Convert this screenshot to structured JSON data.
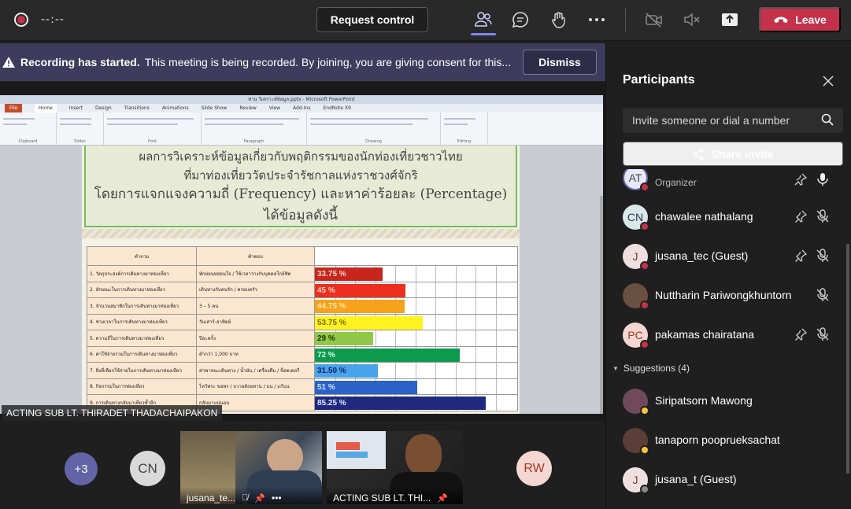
{
  "topbar": {
    "timer": "--:--",
    "request_control": "Request control",
    "leave": "Leave"
  },
  "banner": {
    "title": "Recording has started.",
    "message": "This meeting is being recorded. By joining, you are giving consent for this...",
    "dismiss": "Dismiss"
  },
  "share": {
    "presenter": "ACTING SUB LT. THIRADET THADACHAIPAKON",
    "ppt_title": "ท่าน วิเคราะห์ข้อมูล.pptx - Microsoft PowerPoint",
    "ppt_tabs": [
      "File",
      "Home",
      "Insert",
      "Design",
      "Transitions",
      "Animations",
      "Slide Show",
      "Review",
      "View",
      "Add-Ins",
      "EndNote X9"
    ],
    "ribbon_groups": [
      "Clipboard",
      "Slides",
      "Font",
      "Paragraph",
      "Drawing",
      "Editing"
    ],
    "slide": {
      "line1": "ผลการวิเคราะห์ข้อมูลเกี่ยวกับพฤติกรรมของนักท่องเที่ยวชาวไทย",
      "line2": "ที่มาท่องเที่ยววัดประจำรัชกาลแห่งราชวงศ์จักริ",
      "line3": "โดยการแจกแจงความถี่ (Frequency) และหาค่าร้อยละ (Percentage) ได้ข้อมูลดังนี้",
      "col_q": "คำถาม",
      "col_a": "คำตอบ",
      "rows": [
        {
          "q": "1. วัตถุประสงค์การเดินทางมาท่องเที่ยว",
          "a": "พักผ่อนหย่อนใจ / ใช้เวลาว่างกับบุคคลใกล้ชิด",
          "label": "33.75 %",
          "value": 33.75,
          "color": "#c8251d",
          "text": "#ffd7c9"
        },
        {
          "q": "2. ลักษณะในการเดินทางมาท่องเที่ยว",
          "a": "เดินทางกับคนรัก / ครอบครัว",
          "label": "45 %",
          "value": 45,
          "color": "#ee2e1f",
          "text": "#ffd2c2"
        },
        {
          "q": "3. จำนวนสมาชิกในการเดินทางมาท่องเที่ยว",
          "a": "3 – 5 คน",
          "label": "44.75 %",
          "value": 44.75,
          "color": "#f7a21b",
          "text": "#ffe7a8"
        },
        {
          "q": "4. ช่วงเวลาในการเดินทางมาท่องเที่ยว",
          "a": "วันเสาร์-อาทิตย์",
          "label": "53.75 %",
          "value": 53.75,
          "color": "#fff21f",
          "text": "#7a6a00"
        },
        {
          "q": "5. ความถี่ในการเดินทางมาท่องเที่ยว",
          "a": "ปีละครั้ง",
          "label": "29 %",
          "value": 29,
          "color": "#92c847",
          "text": "#203400"
        },
        {
          "q": "6. ค่าใช้จ่ายรวมในการเดินทางมาท่องเที่ยว",
          "a": "ต่ำกว่า 1,000 บาท",
          "label": "72 %",
          "value": 72,
          "color": "#0e9a4d",
          "text": "#d9ffe6"
        },
        {
          "q": "7. สิ่งที่เลือกใช้จ่ายในการเดินทางมาท่องเที่ยว",
          "a": "ค่าพาหนะเดินทาง / น้ำมัน / เครื่องดื่ม / ช็อตเตอรี่",
          "label": "31.50 %",
          "value": 31.5,
          "color": "#48a3e8",
          "text": "#10206a"
        },
        {
          "q": "8. กิจกรรมในการท่องเที่ยว",
          "a": "ไหว้พระ ขอพร / ถวายสังฆทาน / บน / แก้บน",
          "label": "51 %",
          "value": 51,
          "color": "#2a62c8",
          "text": "#cde0ff"
        },
        {
          "q": "9. การเดินทางกลับมาเที่ยวซ้ำอีก",
          "a": "กลับมาแน่นอน",
          "label": "85.25 %",
          "value": 85.25,
          "color": "#1f2a7e",
          "text": "#e0e6ff"
        }
      ]
    }
  },
  "bottom": {
    "more_count": "+3",
    "cn_initials": "CN",
    "rw_initials": "RW",
    "tile1_name": "jusana_te...",
    "tile2_name": "ACTING SUB LT. THI..."
  },
  "panel": {
    "title": "Participants",
    "invite_placeholder": "Invite someone or dial a number",
    "share_invite": "Share invite",
    "organizer_label": "Organizer",
    "organizer_initials": "AT",
    "participants": [
      {
        "initials": "CN",
        "name": "chawalee nathalang",
        "status_color": "#c4314b"
      },
      {
        "initials": "J",
        "name": "jusana_tec (Guest)",
        "status_color": "#c4314b"
      },
      {
        "initials": "",
        "name": "Nuttharin Pariwongkhuntorn",
        "status_color": "#c4314b"
      },
      {
        "initials": "PC",
        "name": "pakamas chairatana",
        "status_color": "#c4314b"
      }
    ],
    "suggestions_label": "Suggestions (4)",
    "suggestions": [
      {
        "initials": "",
        "name": "Siripatsorn Mawong",
        "status_color": "#f8c53a"
      },
      {
        "initials": "",
        "name": "tanaporn pooprueksachat",
        "status_color": "#f8c53a"
      },
      {
        "initials": "J",
        "name": "jusana_t (Guest)",
        "status_color": "#8a8a8a"
      }
    ]
  },
  "colors": {
    "accent": "#7f85f5",
    "leave": "#c4314b",
    "banner": "#3e3b5c"
  }
}
